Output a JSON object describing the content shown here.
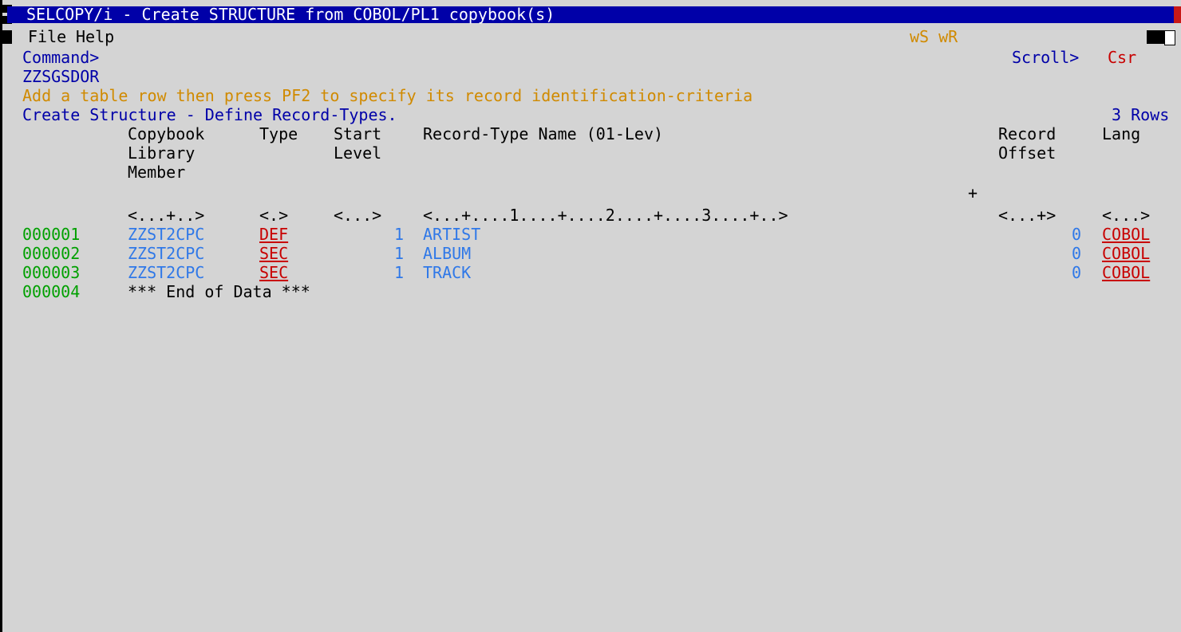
{
  "window": {
    "title": "SELCOPY/i - Create STRUCTURE from COBOL/PL1 copybook(s)"
  },
  "menu": {
    "file": "File",
    "help": "Help",
    "indicators": "wS wR"
  },
  "command": {
    "label": "Command>",
    "value": "",
    "scroll_label": "Scroll>",
    "scroll_value": "Csr"
  },
  "dataset": "ZZSGSDOR",
  "message": "Add a table row then press PF2 to specify its record identification-criteria",
  "panel": {
    "title": "Create Structure - Define Record-Types.",
    "row_count": "3 Rows"
  },
  "table": {
    "headers": {
      "copybook": [
        "Copybook",
        "Library",
        "Member"
      ],
      "type": "Type",
      "start_level": [
        "Start",
        "Level"
      ],
      "record_type_name": "Record-Type Name (01-Lev)",
      "record_offset": [
        "Record",
        "Offset"
      ],
      "lang": "Lang"
    },
    "ruler_plus": "+",
    "rulers": {
      "copybook": "<...+..>",
      "type": "<.>",
      "start_level": "<...>",
      "record_type_name": "<...+....1....+....2....+....3....+..>",
      "record_offset": "<...+>",
      "lang": "<...>"
    },
    "rows": [
      {
        "line": "000001",
        "copybook": "ZZST2CPC",
        "type": "DEF",
        "start_level": "1",
        "name": "ARTIST",
        "offset": "0",
        "lang": "COBOL"
      },
      {
        "line": "000002",
        "copybook": "ZZST2CPC",
        "type": "SEC",
        "start_level": "1",
        "name": "ALBUM",
        "offset": "0",
        "lang": "COBOL"
      },
      {
        "line": "000003",
        "copybook": "ZZST2CPC",
        "type": "SEC",
        "start_level": "1",
        "name": "TRACK",
        "offset": "0",
        "lang": "COBOL"
      }
    ],
    "end_row": {
      "line": "000004",
      "text": "*** End of Data ***"
    }
  },
  "colors": {
    "background": "#d4d4d4",
    "title_bar": "#0000a8",
    "field_blue": "#2f78e8",
    "line_numbers": "#00a000",
    "message": "#d08a00",
    "input_red": "#c80000"
  }
}
